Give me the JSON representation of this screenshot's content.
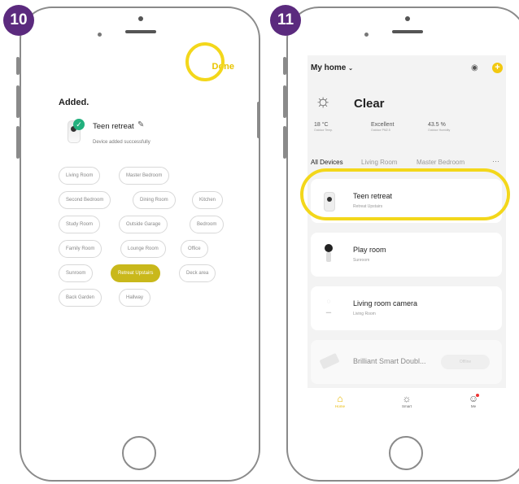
{
  "steps": {
    "left": "10",
    "right": "11"
  },
  "screen10": {
    "done_label": "Done",
    "title": "Added.",
    "device_name": "Teen retreat",
    "device_status": "Device added successfully",
    "rooms": [
      "Living Room",
      "Master Bedroom",
      "Second Bedroom",
      "Dining Room",
      "Kitchen",
      "Study Room",
      "Outside Garage",
      "Bedroom",
      "Family Room",
      "Lounge Room",
      "Office",
      "Sunroom",
      "Retreat Upstairs",
      "Deck area",
      "Back Garden",
      "Hallway"
    ],
    "selected_room": "Retreat Upstairs"
  },
  "screen11": {
    "home_title": "My home",
    "weather": "Clear",
    "stats": [
      {
        "value": "18 °C",
        "label": "Outdoor Temp."
      },
      {
        "value": "Excellent",
        "label": "Outdoor PM2.5"
      },
      {
        "value": "43.5 %",
        "label": "Outdoor Humidity"
      }
    ],
    "tabs": [
      "All Devices",
      "Living Room",
      "Master Bedroom"
    ],
    "active_tab": "All Devices",
    "devices": [
      {
        "name": "Teen retreat",
        "room": "Retreat Upstairs"
      },
      {
        "name": "Play room",
        "room": "Sunroom"
      },
      {
        "name": "Living room camera",
        "room": "Living Room"
      },
      {
        "name": "Brilliant Smart Doubl...",
        "status": "Offline"
      }
    ],
    "tabbar": [
      {
        "label": "Home",
        "icon": "home-icon"
      },
      {
        "label": "Smart",
        "icon": "sun-icon"
      },
      {
        "label": "Me",
        "icon": "user-icon"
      }
    ]
  },
  "colors": {
    "accent": "#f2c80f",
    "highlight": "#f3d71b",
    "badge": "#5b2a7e",
    "success": "#22b07d",
    "selected_chip": "#c9b81b"
  }
}
